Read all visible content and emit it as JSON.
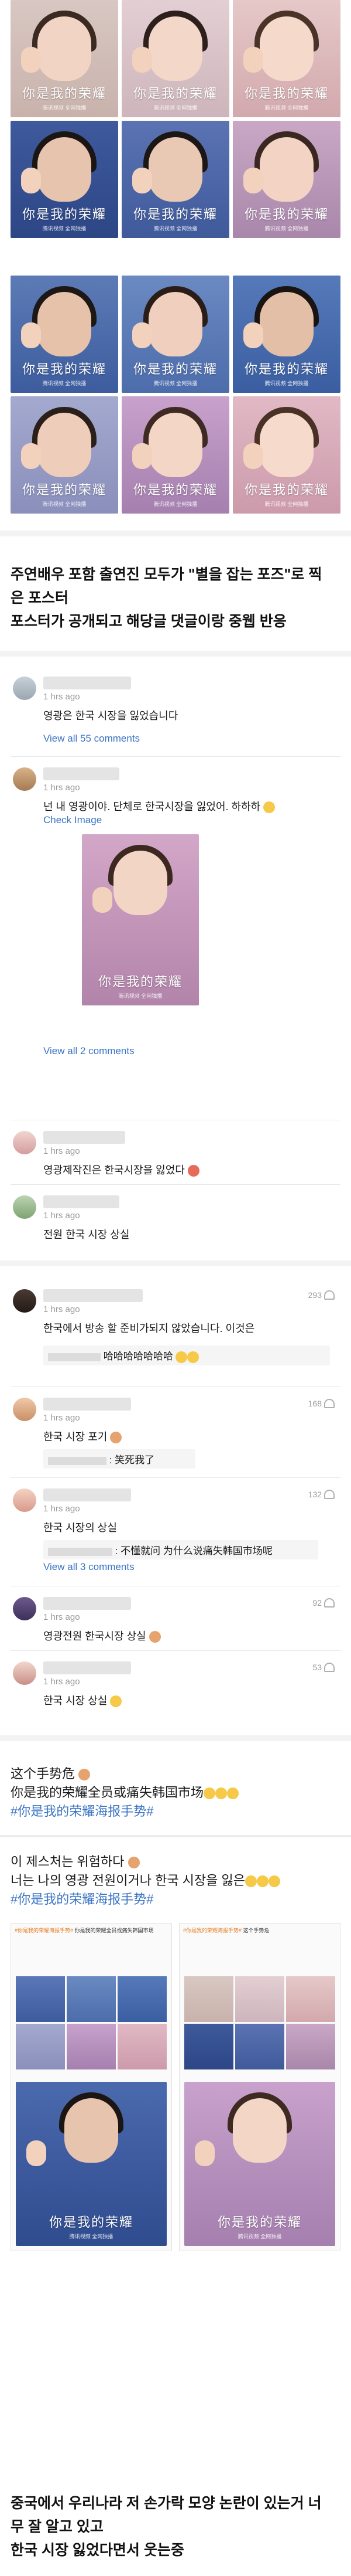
{
  "poster_logo": "你是我的荣耀",
  "poster_sub": "腾讯视频 全网独播",
  "headline": [
    "주연배우 포함 출연진 모두가 \"별을 잡는 포즈\"로 찍",
    "은 포스터",
    "포스터가 공개되고 해당글 댓글이랑 중웹 반응"
  ],
  "comments": [
    {
      "time": "1 hrs ago",
      "text": "영광은 한국 시장을 잃었습니다",
      "view": "View all 55 comments"
    },
    {
      "time": "1 hrs ago",
      "text": "넌 내 영광이야. 단체로 한국시장을 잃었어. 하하하",
      "link": "Check Image",
      "view": "View all 2 comments"
    },
    {
      "time": "1 hrs ago",
      "text": "영광제작진은 한국시장을 잃었다"
    },
    {
      "time": "1 hrs ago",
      "text": "전원 한국 시장 상실"
    },
    {
      "count": "293",
      "time": "1 hrs ago",
      "text": "한국에서 방송 할 준비가되지 않았습니다. 이것은",
      "reply": "哈哈哈哈哈哈哈"
    },
    {
      "count": "168",
      "time": "1 hrs ago",
      "text": "한국 시장 포기",
      "reply": ": 笑死我了"
    },
    {
      "count": "132",
      "time": "1 hrs ago",
      "text": "한국 시장의 상실",
      "reply": ": 不懂就问 为什么说痛失韩国市场呢",
      "view": "View all 3 comments"
    },
    {
      "count": "92",
      "time": "1 hrs ago",
      "text": "영광전원 한국시장 상실"
    },
    {
      "count": "53",
      "time": "1 hrs ago",
      "text": "한국 시장 상실"
    }
  ],
  "weibo1": {
    "line1": "这个手势危",
    "line2": "你是我的荣耀全员或痛失韩国市场",
    "hashtag": "#你是我的荣耀海报手势#"
  },
  "weibo2": {
    "line1": "이 제스처는 위험하다",
    "line2": "너는 나의 영광 전원이거나 한국 시장을 잃은",
    "hashtag": "#你是我的荣耀海报手势#"
  },
  "footer": [
    "중국에서 우리나라 저 손가락 모양 논란이 있는거 너",
    "무 잘 알고 있고",
    "한국 시장 잃었다면서 웃는중"
  ],
  "colors": {
    "link": "#3a74c4",
    "accent": "#e67e22"
  }
}
